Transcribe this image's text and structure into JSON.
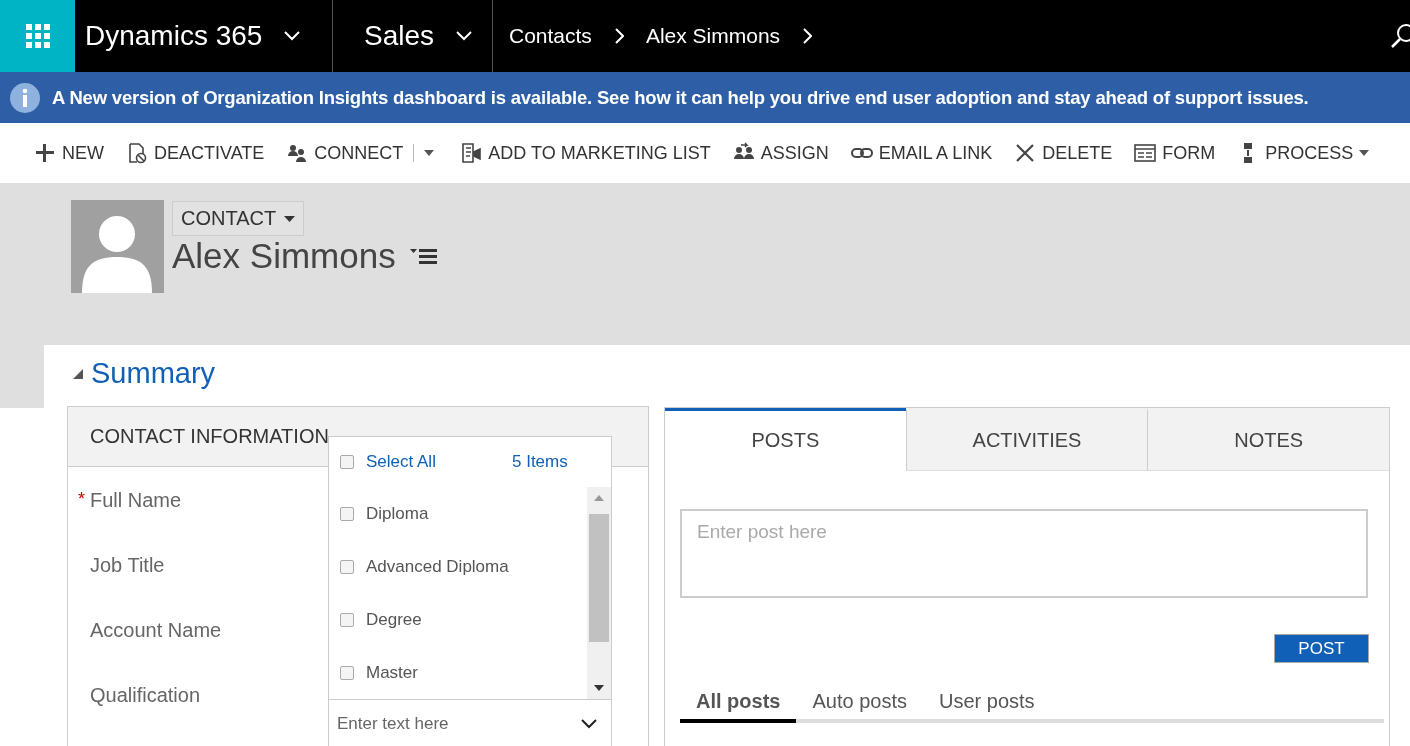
{
  "nav": {
    "product": "Dynamics 365",
    "area": "Sales",
    "breadcrumbs": [
      "Contacts",
      "Alex Simmons"
    ]
  },
  "banner": {
    "text": "A New version of Organization Insights dashboard is available. See how it can help you drive end user adoption and stay ahead of support issues."
  },
  "commands": [
    {
      "label": "NEW",
      "kind": "new",
      "split": false,
      "caret": false
    },
    {
      "label": "DEACTIVATE",
      "kind": "deactivate",
      "split": false,
      "caret": false
    },
    {
      "label": "CONNECT",
      "kind": "connect",
      "split": true,
      "caret": false
    },
    {
      "label": "ADD TO MARKETING LIST",
      "kind": "list",
      "split": false,
      "caret": false
    },
    {
      "label": "ASSIGN",
      "kind": "assign",
      "split": false,
      "caret": false
    },
    {
      "label": "EMAIL A LINK",
      "kind": "link",
      "split": false,
      "caret": false
    },
    {
      "label": "DELETE",
      "kind": "delete",
      "split": false,
      "caret": false
    },
    {
      "label": "FORM",
      "kind": "form",
      "split": false,
      "caret": false
    },
    {
      "label": "PROCESS",
      "kind": "process",
      "split": false,
      "caret": true
    }
  ],
  "record": {
    "entity": "CONTACT",
    "name": "Alex Simmons"
  },
  "section": {
    "title": "Summary",
    "expanded": true
  },
  "contact_information": {
    "title": "CONTACT INFORMATION",
    "fields": [
      {
        "label": "Full Name",
        "required_mark": "*"
      },
      {
        "label": "Job Title"
      },
      {
        "label": "Account Name"
      },
      {
        "label": "Qualification"
      }
    ]
  },
  "multiselect": {
    "select_all": {
      "label": "Select All",
      "checked": false
    },
    "count": "5 Items",
    "options": [
      {
        "label": "Diploma",
        "checked": false
      },
      {
        "label": "Advanced Diploma",
        "checked": false
      },
      {
        "label": "Degree",
        "checked": false
      },
      {
        "label": "Master",
        "checked": false
      }
    ],
    "placeholder": "Enter text here"
  },
  "tabs": [
    {
      "label": "POSTS",
      "selected": true
    },
    {
      "label": "ACTIVITIES",
      "selected": false
    },
    {
      "label": "NOTES",
      "selected": false
    }
  ],
  "post_box": {
    "placeholder": "Enter post here"
  },
  "post_button": "POST",
  "filters": [
    {
      "label": "All posts",
      "selected": true
    },
    {
      "label": "Auto posts",
      "selected": false
    },
    {
      "label": "User posts",
      "selected": false
    }
  ]
}
